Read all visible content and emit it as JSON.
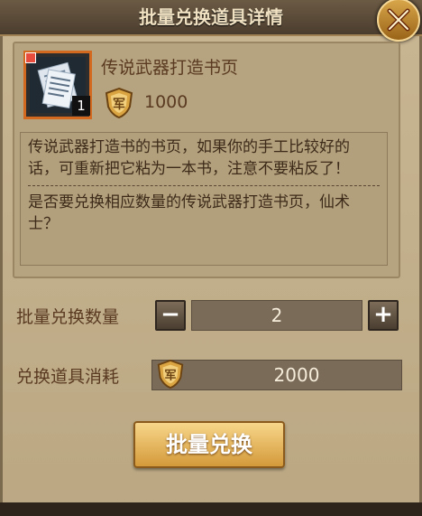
{
  "dialog": {
    "title": "批量兑换道具详情"
  },
  "item": {
    "name": "传说武器打造书页",
    "quantity_badge": "1",
    "price": "1000",
    "icon": "scroll-pages-icon",
    "currency_icon": "bronze-shield-badge-icon"
  },
  "description": {
    "text": "传说武器打造书的书页，如果你的手工比较好的话，可重新把它粘为一本书，注意不要粘反了！",
    "prompt": "是否要兑换相应数量的传说武器打造书页，仙术士？"
  },
  "quantity_row": {
    "label": "批量兑换数量",
    "value": "2",
    "minus_symbol": "−",
    "plus_symbol": "+"
  },
  "cost_row": {
    "label": "兑换道具消耗",
    "value": "2000"
  },
  "action": {
    "label": "批量兑换"
  },
  "colors": {
    "frame_border": "#d2691e",
    "button_gold": "#e6b34f",
    "text_brown": "#5a3b22"
  }
}
